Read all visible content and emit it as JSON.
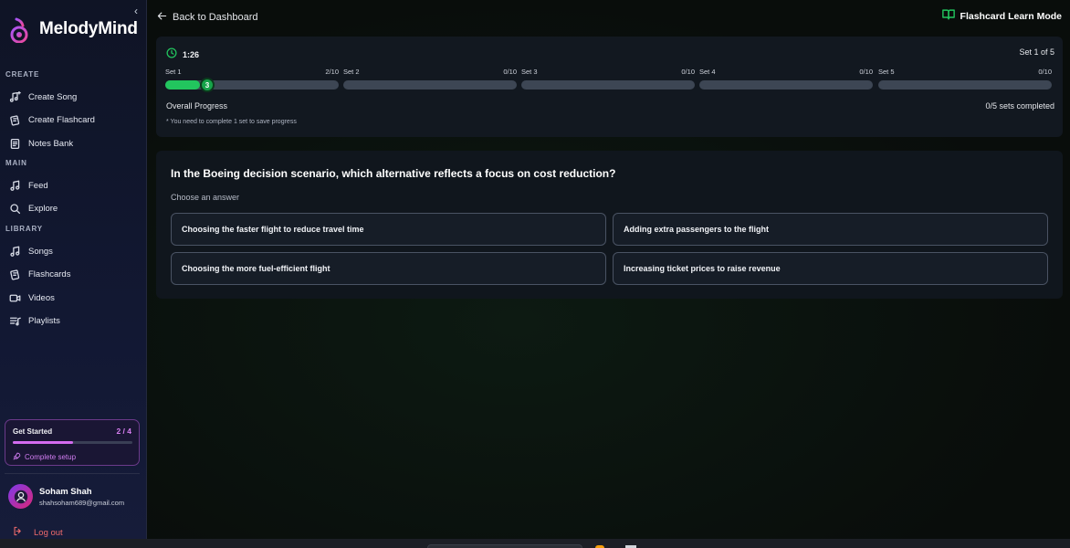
{
  "brand": {
    "name": "MelodyMind"
  },
  "sidebar": {
    "sections": {
      "create": "CREATE",
      "main": "MAIN",
      "library": "LIBRARY"
    },
    "create_items": [
      {
        "label": "Create Song",
        "icon": "music-plus-icon"
      },
      {
        "label": "Create Flashcard",
        "icon": "cards-icon"
      },
      {
        "label": "Notes Bank",
        "icon": "notes-icon"
      }
    ],
    "main_items": [
      {
        "label": "Feed",
        "icon": "music-note-icon"
      },
      {
        "label": "Explore",
        "icon": "search-icon"
      }
    ],
    "library_items": [
      {
        "label": "Songs",
        "icon": "music-note-icon"
      },
      {
        "label": "Flashcards",
        "icon": "cards-icon"
      },
      {
        "label": "Videos",
        "icon": "video-icon"
      },
      {
        "label": "Playlists",
        "icon": "playlist-icon"
      }
    ],
    "get_started": {
      "title": "Get Started",
      "count": "2 / 4",
      "progress": 0.5,
      "link": "Complete setup"
    },
    "user": {
      "name": "Soham Shah",
      "email": "shahsoham689@gmail.com"
    },
    "logout": "Log out"
  },
  "header": {
    "back": "Back to Dashboard",
    "mode": "Flashcard Learn Mode"
  },
  "progress": {
    "timer": "1:26",
    "set_of": "Set 1 of 5",
    "sets": [
      {
        "name": "Set 1",
        "count": "2/10",
        "fraction": 0.2,
        "current": "3"
      },
      {
        "name": "Set 2",
        "count": "0/10",
        "fraction": 0
      },
      {
        "name": "Set 3",
        "count": "0/10",
        "fraction": 0
      },
      {
        "name": "Set 4",
        "count": "0/10",
        "fraction": 0
      },
      {
        "name": "Set 5",
        "count": "0/10",
        "fraction": 0
      }
    ],
    "overall_label": "Overall Progress",
    "completed": "0/5 sets completed",
    "note": "* You need to complete 1 set to save progress"
  },
  "question": {
    "text": "In the Boeing decision scenario, which alternative reflects a focus on cost reduction?",
    "hint": "Choose an answer",
    "answers": [
      "Choosing the faster flight to reduce travel time",
      "Adding extra passengers to the flight",
      "Choosing the more fuel-efficient flight",
      "Increasing ticket prices to raise revenue"
    ]
  },
  "colors": {
    "accent_green": "#22c55e",
    "accent_purple": "#d46bf0",
    "logout_red": "#ef6b6b"
  }
}
